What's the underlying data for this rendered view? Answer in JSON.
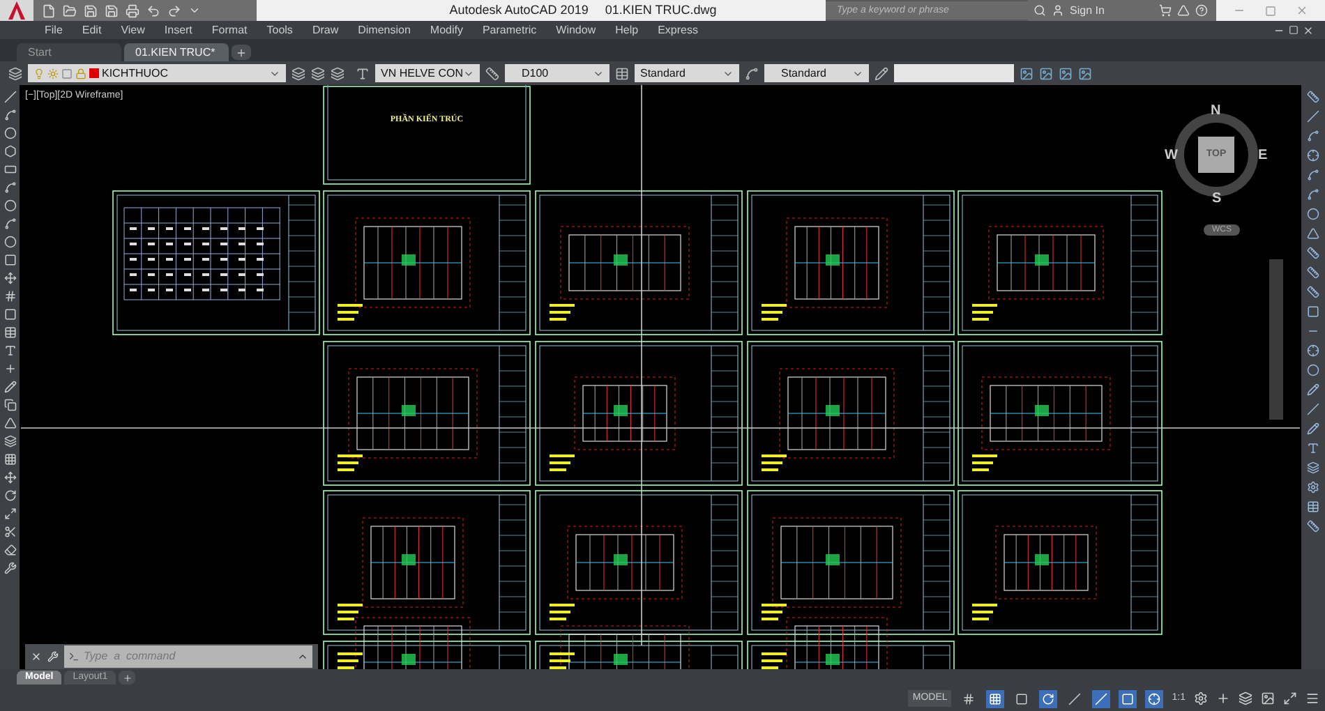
{
  "title_bar": {
    "title": "Autodesk AutoCAD 2019",
    "file": "01.KIEN TRUC.dwg",
    "search": {
      "placeholder": "Type a keyword or phrase"
    },
    "sign_in": "Sign In"
  },
  "menu": [
    "File",
    "Edit",
    "View",
    "Insert",
    "Format",
    "Tools",
    "Draw",
    "Dimension",
    "Modify",
    "Parametric",
    "Window",
    "Help",
    "Express"
  ],
  "tabs": [
    {
      "label": "Start",
      "selected": false
    },
    {
      "label": "01.KIEN TRUC*",
      "selected": true
    }
  ],
  "properties": {
    "layer": "KICHTHUOC",
    "text_style": "VN HELVE CON",
    "dim_style": "D100",
    "table_style": "Standard",
    "multileader_style": "Standard"
  },
  "viewport_label": "[−][Top][2D Wireframe]",
  "drawing": {
    "sheet_title": "PHẦN KIẾN TRÚC"
  },
  "viewcube": {
    "north": "N",
    "south": "S",
    "east": "E",
    "west": "W",
    "face": "TOP",
    "ucs": "WCS"
  },
  "command": {
    "placeholder": "Type  a  command"
  },
  "layout_tabs": [
    {
      "label": "Model",
      "selected": true
    },
    {
      "label": "Layout1",
      "selected": false
    }
  ],
  "status_bar": {
    "model": "MODEL",
    "scale": "1:1",
    "toggles": [
      {
        "kind": "grid",
        "on": false
      },
      {
        "kind": "snap",
        "on": true
      },
      {
        "kind": "ortho",
        "on": false
      },
      {
        "kind": "polar",
        "on": true
      },
      {
        "kind": "isodraft",
        "on": false
      },
      {
        "kind": "osnap-track",
        "on": true
      },
      {
        "kind": "osnap",
        "on": true
      },
      {
        "kind": "annot-visible",
        "on": true
      }
    ]
  }
}
